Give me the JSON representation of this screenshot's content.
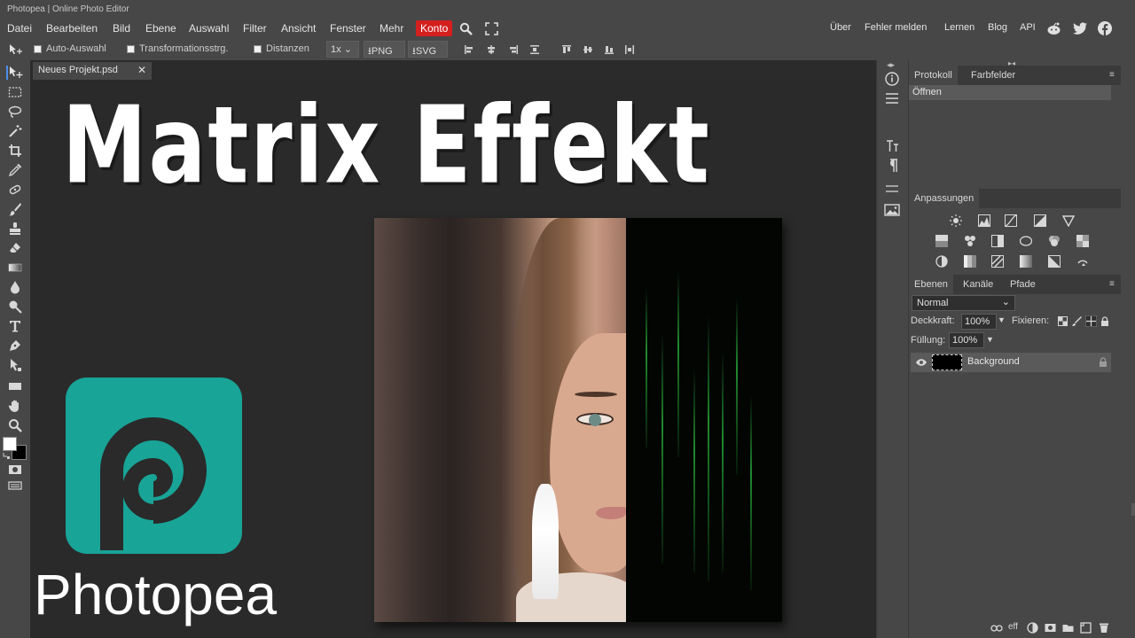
{
  "window": {
    "title": "Photopea | Online Photo Editor"
  },
  "menu": {
    "items": [
      "Datei",
      "Bearbeiten",
      "Bild",
      "Ebene",
      "Auswahl",
      "Filter",
      "Ansicht",
      "Fenster",
      "Mehr"
    ],
    "account": "Konto",
    "right_links": [
      "Über",
      "Fehler melden",
      "Lernen",
      "Blog",
      "API"
    ],
    "accent_color": "#d41f1f"
  },
  "options": {
    "auto_select": "Auto-Auswahl",
    "transform_controls": "Transformationsstrg.",
    "distances": "Distanzen",
    "zoom": "1x",
    "export_png": "PNG",
    "export_svg": "SVG"
  },
  "document": {
    "tab_title": "Neues Projekt.psd"
  },
  "thumbnail": {
    "headline": "Matrix Effekt",
    "brand": "Photopea",
    "brand_color": "#18a497"
  },
  "panels": {
    "history": {
      "tabs": [
        "Protokoll",
        "Farbfelder"
      ],
      "entries": [
        "Öffnen"
      ]
    },
    "adjustments": {
      "tab": "Anpassungen"
    },
    "layers": {
      "tabs": [
        "Ebenen",
        "Kanäle",
        "Pfade"
      ],
      "blend_mode": "Normal",
      "opacity_label": "Deckkraft:",
      "opacity_value": "100%",
      "lock_label": "Fixieren:",
      "fill_label": "Füllung:",
      "fill_value": "100%",
      "items": [
        {
          "name": "Background",
          "locked": true,
          "visible": true
        }
      ]
    }
  }
}
